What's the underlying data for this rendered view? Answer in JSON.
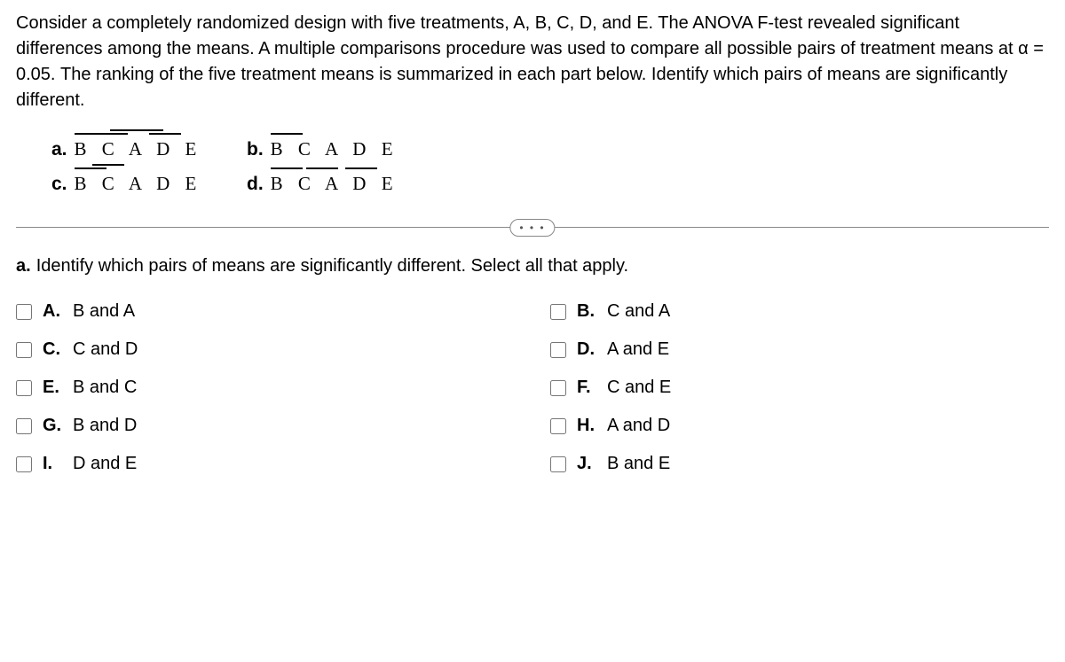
{
  "question": {
    "text": "Consider a completely randomized design with five treatments, A, B, C, D, and E. The ANOVA F-test revealed significant differences among the means. A multiple comparisons procedure was used to compare all possible pairs of treatment means at α = 0.05. The ranking of the five treatment means is summarized in each part below. Identify which pairs of means are significantly different."
  },
  "parts": {
    "a": {
      "label": "a.",
      "letters": "B C A D E"
    },
    "b": {
      "label": "b.",
      "letters": "B C A D E"
    },
    "c": {
      "label": "c.",
      "letters": "B C A D E"
    },
    "d": {
      "label": "d.",
      "letters": "B C A D E"
    }
  },
  "divider": {
    "dots": "• • •"
  },
  "subQuestion": {
    "label": "a.",
    "text": "Identify which pairs of means are significantly different. Select all that apply."
  },
  "options": {
    "A": {
      "letter": "A.",
      "text": "B and A"
    },
    "B": {
      "letter": "B.",
      "text": "C and A"
    },
    "C": {
      "letter": "C.",
      "text": "C and D"
    },
    "D": {
      "letter": "D.",
      "text": "A and E"
    },
    "E": {
      "letter": "E.",
      "text": "B and C"
    },
    "F": {
      "letter": "F.",
      "text": "C and E"
    },
    "G": {
      "letter": "G.",
      "text": "B and D"
    },
    "H": {
      "letter": "H.",
      "text": "A and D"
    },
    "I": {
      "letter": "I.",
      "text": "D and E"
    },
    "J": {
      "letter": "J.",
      "text": "B and E"
    }
  }
}
